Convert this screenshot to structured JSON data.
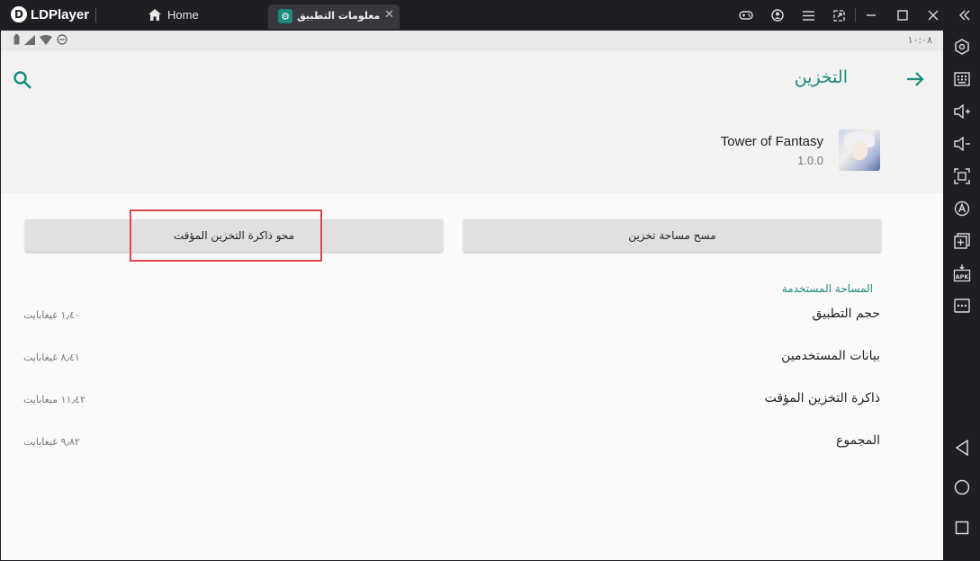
{
  "titlebar": {
    "brand": "LDPlayer",
    "home_tab": "Home",
    "active_tab": "معلومات التطبيق",
    "controls": [
      "gamepad-icon",
      "account-icon",
      "menu-icon",
      "resize-icon",
      "minimize-icon",
      "maximize-icon",
      "close-icon",
      "collapse-icon"
    ]
  },
  "statusbar": {
    "time": "١٠:٠٨"
  },
  "header": {
    "title": "التخزين"
  },
  "app": {
    "name": "Tower of Fantasy",
    "version": "1.0.0"
  },
  "buttons": {
    "clear_storage": "مسح مساحة تخزين",
    "clear_cache": "محو ذاكرة التخزين المؤقت"
  },
  "storage": {
    "section_title": "المساحة المستخدمة",
    "rows": [
      {
        "label": "حجم التطبيق",
        "value": "١٫٤٠ غيغابايت"
      },
      {
        "label": "بيانات المستخدمين",
        "value": "٨٫٤١ غيغابايت"
      },
      {
        "label": "ذاكرة التخزين المؤقت",
        "value": "١١٫٤٢ ميغابايت"
      },
      {
        "label": "المجموع",
        "value": "٩٫٨٢ غيغابايت"
      }
    ]
  },
  "colors": {
    "accent": "#1a8a7d",
    "highlight": "#e0444c"
  }
}
